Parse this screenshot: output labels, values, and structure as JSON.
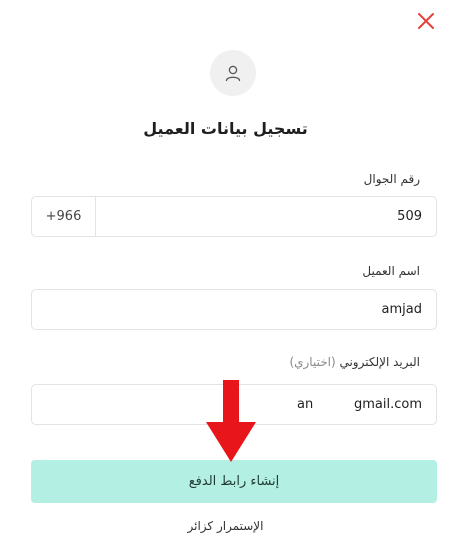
{
  "dialog": {
    "title": "تسجيل بيانات العميل",
    "close_icon": "close-icon",
    "avatar_icon": "user-icon",
    "accent_color": "#e5413a"
  },
  "form": {
    "phone": {
      "label": "رقم الجوال",
      "country_code": "+966",
      "value": "509"
    },
    "name": {
      "label": "اسم العميل",
      "value": "amjad"
    },
    "email": {
      "label": "البريد الإلكتروني",
      "optional_label": "(اختياري)",
      "value_local": "an",
      "value_domain": "gmail.com"
    }
  },
  "actions": {
    "create_payment_link": "إنشاء رابط الدفع",
    "continue_as_guest": "الإستمرار كزائر",
    "primary_color": "#b3efe2"
  },
  "annotation": {
    "arrow_icon": "down-arrow-icon",
    "arrow_color": "#e8151b"
  }
}
